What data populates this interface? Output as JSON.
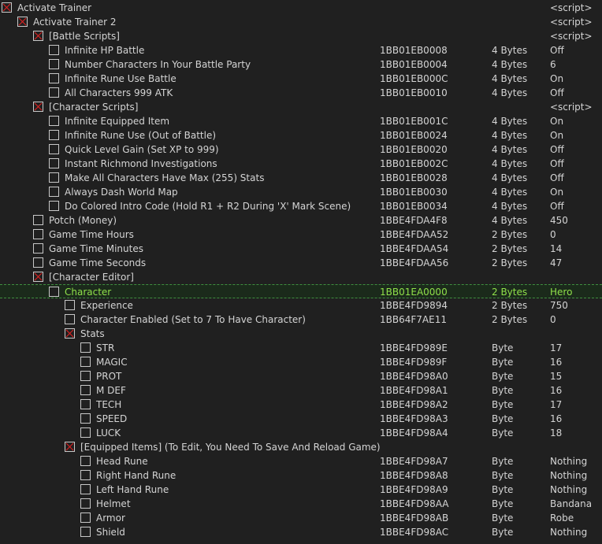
{
  "rows": [
    {
      "description": "Activate Trainer",
      "address": "",
      "type": "",
      "value": "<script>",
      "level": 0,
      "checked": true
    },
    {
      "description": "Activate Trainer 2",
      "address": "",
      "type": "",
      "value": "<script>",
      "level": 1,
      "checked": true
    },
    {
      "description": "[Battle Scripts]",
      "address": "",
      "type": "",
      "value": "<script>",
      "level": 2,
      "checked": true
    },
    {
      "description": "Infinite HP Battle",
      "address": "1BB01EB0008",
      "type": "4 Bytes",
      "value": "Off",
      "level": 3,
      "checked": false
    },
    {
      "description": "Number Characters In Your Battle Party",
      "address": "1BB01EB0004",
      "type": "4 Bytes",
      "value": "6",
      "level": 3,
      "checked": false
    },
    {
      "description": "Infinite Rune Use Battle",
      "address": "1BB01EB000C",
      "type": "4 Bytes",
      "value": "On",
      "level": 3,
      "checked": false
    },
    {
      "description": "All Characters 999 ATK",
      "address": "1BB01EB0010",
      "type": "4 Bytes",
      "value": "Off",
      "level": 3,
      "checked": false
    },
    {
      "description": "[Character Scripts]",
      "address": "",
      "type": "",
      "value": "<script>",
      "level": 2,
      "checked": true
    },
    {
      "description": "Infinite Equipped Item",
      "address": "1BB01EB001C",
      "type": "4 Bytes",
      "value": "On",
      "level": 3,
      "checked": false
    },
    {
      "description": "Infinite Rune Use (Out of Battle)",
      "address": "1BB01EB0024",
      "type": "4 Bytes",
      "value": "On",
      "level": 3,
      "checked": false
    },
    {
      "description": "Quick Level Gain (Set XP to 999)",
      "address": "1BB01EB0020",
      "type": "4 Bytes",
      "value": "Off",
      "level": 3,
      "checked": false
    },
    {
      "description": "Instant Richmond Investigations",
      "address": "1BB01EB002C",
      "type": "4 Bytes",
      "value": "Off",
      "level": 3,
      "checked": false
    },
    {
      "description": "Make All Characters Have Max (255) Stats",
      "address": "1BB01EB0028",
      "type": "4 Bytes",
      "value": "Off",
      "level": 3,
      "checked": false
    },
    {
      "description": "Always Dash World Map",
      "address": "1BB01EB0030",
      "type": "4 Bytes",
      "value": "On",
      "level": 3,
      "checked": false
    },
    {
      "description": "Do Colored Intro Code (Hold R1 + R2 During 'X' Mark Scene)",
      "address": "1BB01EB0034",
      "type": "4 Bytes",
      "value": "Off",
      "level": 3,
      "checked": false
    },
    {
      "description": "Potch (Money)",
      "address": "1BBE4FDA4F8",
      "type": "4 Bytes",
      "value": "450",
      "level": 2,
      "checked": false
    },
    {
      "description": "Game Time Hours",
      "address": "1BBE4FDAA52",
      "type": "2 Bytes",
      "value": "0",
      "level": 2,
      "checked": false
    },
    {
      "description": "Game Time Minutes",
      "address": "1BBE4FDAA54",
      "type": "2 Bytes",
      "value": "14",
      "level": 2,
      "checked": false
    },
    {
      "description": "Game Time Seconds",
      "address": "1BBE4FDAA56",
      "type": "2 Bytes",
      "value": "47",
      "level": 2,
      "checked": false
    },
    {
      "description": "[Character Editor]",
      "address": "",
      "type": "",
      "value": "",
      "level": 2,
      "checked": true
    },
    {
      "description": "Character",
      "address": "1BB01EA0000",
      "type": "2 Bytes",
      "value": "Hero",
      "level": 3,
      "checked": false,
      "selected": true
    },
    {
      "description": "Experience",
      "address": "1BBE4FD9894",
      "type": "2 Bytes",
      "value": "750",
      "level": 4,
      "checked": false
    },
    {
      "description": "Character Enabled (Set to 7 To Have Character)",
      "address": "1BB64F7AE11",
      "type": "2 Bytes",
      "value": "0",
      "level": 4,
      "checked": false
    },
    {
      "description": "Stats",
      "address": "",
      "type": "",
      "value": "",
      "level": 4,
      "checked": true
    },
    {
      "description": "STR",
      "address": "1BBE4FD989E",
      "type": "Byte",
      "value": "17",
      "level": 5,
      "checked": false
    },
    {
      "description": "MAGIC",
      "address": "1BBE4FD989F",
      "type": "Byte",
      "value": "16",
      "level": 5,
      "checked": false
    },
    {
      "description": "PROT",
      "address": "1BBE4FD98A0",
      "type": "Byte",
      "value": "15",
      "level": 5,
      "checked": false
    },
    {
      "description": "M DEF",
      "address": "1BBE4FD98A1",
      "type": "Byte",
      "value": "16",
      "level": 5,
      "checked": false
    },
    {
      "description": "TECH",
      "address": "1BBE4FD98A2",
      "type": "Byte",
      "value": "17",
      "level": 5,
      "checked": false
    },
    {
      "description": "SPEED",
      "address": "1BBE4FD98A3",
      "type": "Byte",
      "value": "16",
      "level": 5,
      "checked": false
    },
    {
      "description": "LUCK",
      "address": "1BBE4FD98A4",
      "type": "Byte",
      "value": "18",
      "level": 5,
      "checked": false
    },
    {
      "description": "[Equipped Items] (To Edit, You Need To Save And Reload Game)",
      "address": "",
      "type": "",
      "value": "",
      "level": 4,
      "checked": true
    },
    {
      "description": "Head Rune",
      "address": "1BBE4FD98A7",
      "type": "Byte",
      "value": "Nothing",
      "level": 5,
      "checked": false
    },
    {
      "description": "Right Hand Rune",
      "address": "1BBE4FD98A8",
      "type": "Byte",
      "value": "Nothing",
      "level": 5,
      "checked": false
    },
    {
      "description": "Left Hand Rune",
      "address": "1BBE4FD98A9",
      "type": "Byte",
      "value": "Nothing",
      "level": 5,
      "checked": false
    },
    {
      "description": "Helmet",
      "address": "1BBE4FD98AA",
      "type": "Byte",
      "value": "Bandana",
      "level": 5,
      "checked": false
    },
    {
      "description": "Armor",
      "address": "1BBE4FD98AB",
      "type": "Byte",
      "value": "Robe",
      "level": 5,
      "checked": false
    },
    {
      "description": "Shield",
      "address": "1BBE4FD98AC",
      "type": "Byte",
      "value": "Nothing",
      "level": 5,
      "checked": false
    }
  ]
}
